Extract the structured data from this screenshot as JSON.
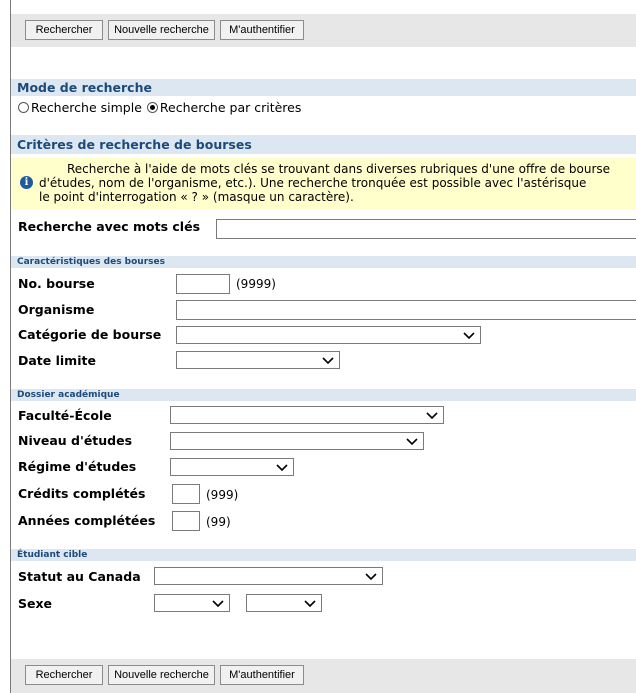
{
  "toolbar": {
    "search_label": "Rechercher",
    "new_search_label": "Nouvelle recherche",
    "auth_label": "M'authentifier"
  },
  "mode": {
    "title": "Mode de recherche",
    "option_simple": "Recherche simple",
    "option_criteria": "Recherche par critères",
    "selected": "Recherche par critères"
  },
  "criteria": {
    "title": "Critères de recherche de bourses",
    "info_line1": "Recherche à l'aide de mots clés se trouvant dans diverses rubriques d'une offre de bourse",
    "info_line2": "d'études, nom de l'organisme, etc.). Une recherche tronquée est possible avec l'astérisque",
    "info_line3": "le point d'interrogation « ? » (masque un caractère).",
    "keywords_label": "Recherche avec mots clés",
    "keywords_value": ""
  },
  "characteristics": {
    "title": "Caractéristiques des bourses",
    "no_bourse_label": "No. bourse",
    "no_bourse_hint": "(9999)",
    "organisme_label": "Organisme",
    "categorie_label": "Catégorie de bourse",
    "date_limite_label": "Date limite"
  },
  "academic": {
    "title": "Dossier académique",
    "faculte_label": "Faculté-École",
    "niveau_label": "Niveau d'études",
    "regime_label": "Régime d'études",
    "credits_label": "Crédits complétés",
    "credits_hint": "(999)",
    "annees_label": "Années complétées",
    "annees_hint": "(99)"
  },
  "student": {
    "title": "Étudiant cible",
    "statut_label": "Statut au Canada",
    "sexe_label": "Sexe"
  }
}
